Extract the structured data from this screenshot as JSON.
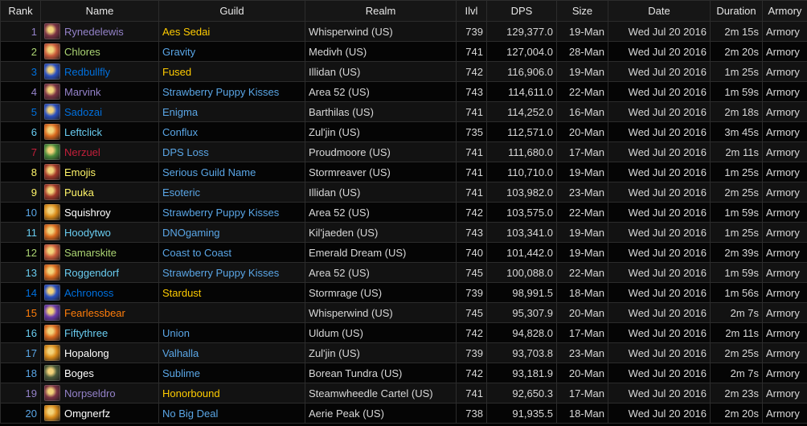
{
  "headers": {
    "rank": "Rank",
    "name": "Name",
    "guild": "Guild",
    "realm": "Realm",
    "ilvl": "Ilvl",
    "dps": "DPS",
    "size": "Size",
    "date": "Date",
    "duration": "Duration",
    "armory": "Armory"
  },
  "colors": {
    "guild_orange": "#ffcc00",
    "guild_blue": "#5aa6e6",
    "realm": "#5aa6e6",
    "dps": "#9ccc38",
    "armory": "#5aa6e6"
  },
  "rows": [
    {
      "rank": "1",
      "name": "Rynedelewis",
      "class_color": "#9482c9",
      "icon": "warlock-portrait-icon",
      "icon_color": "#7a3344",
      "guild": "Aes Sedai",
      "guild_color": "#ffcc00",
      "realm": "Whisperwind (US)",
      "ilvl": "739",
      "dps": "129,377.0",
      "size": "19-Man",
      "date": "Wed Jul 20 2016",
      "duration": "2m 15s",
      "armory": "Armory"
    },
    {
      "rank": "2",
      "name": "Chlores",
      "class_color": "#abd473",
      "icon": "hunter-portrait-icon",
      "icon_color": "#c85a3a",
      "guild": "Gravity",
      "guild_color": "#5aa6e6",
      "realm": "Medivh (US)",
      "ilvl": "741",
      "dps": "127,004.0",
      "size": "28-Man",
      "date": "Wed Jul 20 2016",
      "duration": "2m 20s",
      "armory": "Armory"
    },
    {
      "rank": "3",
      "name": "Redbullfly",
      "class_color": "#0070de",
      "icon": "shaman-lightning-icon",
      "icon_color": "#2a4fbf",
      "guild": "Fused",
      "guild_color": "#ffcc00",
      "realm": "Illidan (US)",
      "ilvl": "742",
      "dps": "116,906.0",
      "size": "19-Man",
      "date": "Wed Jul 20 2016",
      "duration": "1m 25s",
      "armory": "Armory"
    },
    {
      "rank": "4",
      "name": "Marvink",
      "class_color": "#9482c9",
      "icon": "warlock-portrait-icon",
      "icon_color": "#7a3344",
      "guild": "Strawberry Puppy Kisses",
      "guild_color": "#5aa6e6",
      "realm": "Area 52 (US)",
      "ilvl": "743",
      "dps": "114,611.0",
      "size": "22-Man",
      "date": "Wed Jul 20 2016",
      "duration": "1m 59s",
      "armory": "Armory"
    },
    {
      "rank": "5",
      "name": "Sadozai",
      "class_color": "#0070de",
      "icon": "shaman-lightning-icon",
      "icon_color": "#2a4fbf",
      "guild": "Enigma",
      "guild_color": "#5aa6e6",
      "realm": "Barthilas (US)",
      "ilvl": "741",
      "dps": "114,252.0",
      "size": "16-Man",
      "date": "Wed Jul 20 2016",
      "duration": "2m 18s",
      "armory": "Armory"
    },
    {
      "rank": "6",
      "name": "Leftclick",
      "class_color": "#69ccf0",
      "icon": "mage-fire-icon",
      "icon_color": "#d8681e",
      "guild": "Conflux",
      "guild_color": "#5aa6e6",
      "realm": "Zul'jin (US)",
      "ilvl": "735",
      "dps": "112,571.0",
      "size": "20-Man",
      "date": "Wed Jul 20 2016",
      "duration": "3m 45s",
      "armory": "Armory"
    },
    {
      "rank": "7",
      "name": "Nerzuel",
      "class_color": "#c41f3b",
      "icon": "death-knight-skull-icon",
      "icon_color": "#4a8a3a",
      "guild": "DPS Loss",
      "guild_color": "#5aa6e6",
      "realm": "Proudmoore (US)",
      "ilvl": "741",
      "dps": "111,680.0",
      "size": "17-Man",
      "date": "Wed Jul 20 2016",
      "duration": "2m 11s",
      "armory": "Armory"
    },
    {
      "rank": "8",
      "name": "Emojis",
      "class_color": "#fff569",
      "icon": "rogue-portrait-icon",
      "icon_color": "#a33a2a",
      "guild": "Serious Guild Name",
      "guild_color": "#5aa6e6",
      "realm": "Stormreaver (US)",
      "ilvl": "741",
      "dps": "110,710.0",
      "size": "19-Man",
      "date": "Wed Jul 20 2016",
      "duration": "1m 25s",
      "armory": "Armory"
    },
    {
      "rank": "9",
      "name": "Puuka",
      "class_color": "#fff569",
      "icon": "rogue-portrait-icon",
      "icon_color": "#a33a2a",
      "guild": "Esoteric",
      "guild_color": "#5aa6e6",
      "realm": "Illidan (US)",
      "ilvl": "741",
      "dps": "103,982.0",
      "size": "23-Man",
      "date": "Wed Jul 20 2016",
      "duration": "2m 25s",
      "armory": "Armory"
    },
    {
      "rank": "10",
      "name": "Squishroy",
      "class_color": "#ffffff",
      "icon": "priest-shadow-icon",
      "icon_color": "#d88a1a",
      "guild": "Strawberry Puppy Kisses",
      "guild_color": "#5aa6e6",
      "realm": "Area 52 (US)",
      "ilvl": "742",
      "dps": "103,575.0",
      "size": "22-Man",
      "date": "Wed Jul 20 2016",
      "duration": "1m 59s",
      "armory": "Armory"
    },
    {
      "rank": "11",
      "name": "Hoodytwo",
      "class_color": "#69ccf0",
      "icon": "mage-fire-icon",
      "icon_color": "#d8681e",
      "guild": "DNOgaming",
      "guild_color": "#5aa6e6",
      "realm": "Kil'jaeden (US)",
      "ilvl": "743",
      "dps": "103,341.0",
      "size": "19-Man",
      "date": "Wed Jul 20 2016",
      "duration": "1m 25s",
      "armory": "Armory"
    },
    {
      "rank": "12",
      "name": "Samarskite",
      "class_color": "#abd473",
      "icon": "hunter-portrait-icon",
      "icon_color": "#c85a3a",
      "guild": "Coast to Coast",
      "guild_color": "#5aa6e6",
      "realm": "Emerald Dream (US)",
      "ilvl": "740",
      "dps": "101,442.0",
      "size": "19-Man",
      "date": "Wed Jul 20 2016",
      "duration": "2m 39s",
      "armory": "Armory"
    },
    {
      "rank": "13",
      "name": "Roggendorf",
      "class_color": "#69ccf0",
      "icon": "mage-fire-icon",
      "icon_color": "#d8681e",
      "guild": "Strawberry Puppy Kisses",
      "guild_color": "#5aa6e6",
      "realm": "Area 52 (US)",
      "ilvl": "745",
      "dps": "100,088.0",
      "size": "22-Man",
      "date": "Wed Jul 20 2016",
      "duration": "1m 59s",
      "armory": "Armory"
    },
    {
      "rank": "14",
      "name": "Achronoss",
      "class_color": "#0070de",
      "icon": "shaman-lightning-icon",
      "icon_color": "#2a4fbf",
      "guild": "Stardust",
      "guild_color": "#ffcc00",
      "realm": "Stormrage (US)",
      "ilvl": "739",
      "dps": "98,991.5",
      "size": "18-Man",
      "date": "Wed Jul 20 2016",
      "duration": "1m 56s",
      "armory": "Armory"
    },
    {
      "rank": "15",
      "name": "Fearlessbear",
      "class_color": "#ff7d0a",
      "icon": "druid-starfall-icon",
      "icon_color": "#6a3aa8",
      "guild": "",
      "guild_color": "#5aa6e6",
      "realm": "Whisperwind (US)",
      "ilvl": "745",
      "dps": "95,307.9",
      "size": "20-Man",
      "date": "Wed Jul 20 2016",
      "duration": "2m 7s",
      "armory": "Armory"
    },
    {
      "rank": "16",
      "name": "Fiftythree",
      "class_color": "#69ccf0",
      "icon": "mage-fire-icon",
      "icon_color": "#d8681e",
      "guild": "Union",
      "guild_color": "#5aa6e6",
      "realm": "Uldum (US)",
      "ilvl": "742",
      "dps": "94,828.0",
      "size": "17-Man",
      "date": "Wed Jul 20 2016",
      "duration": "2m 11s",
      "armory": "Armory"
    },
    {
      "rank": "17",
      "name": "Hopalong",
      "class_color": "#ffffff",
      "icon": "priest-shadow-icon",
      "icon_color": "#d88a1a",
      "guild": "Valhalla",
      "guild_color": "#5aa6e6",
      "realm": "Zul'jin (US)",
      "ilvl": "739",
      "dps": "93,703.8",
      "size": "23-Man",
      "date": "Wed Jul 20 2016",
      "duration": "2m 25s",
      "armory": "Armory"
    },
    {
      "rank": "18",
      "name": "Boges",
      "class_color": "#ffffff",
      "icon": "priest-hood-icon",
      "icon_color": "#4a5a3a",
      "guild": "Sublime",
      "guild_color": "#5aa6e6",
      "realm": "Borean Tundra (US)",
      "ilvl": "742",
      "dps": "93,181.9",
      "size": "20-Man",
      "date": "Wed Jul 20 2016",
      "duration": "2m 7s",
      "armory": "Armory"
    },
    {
      "rank": "19",
      "name": "Norpseldro",
      "class_color": "#9482c9",
      "icon": "warlock-portrait-icon",
      "icon_color": "#7a3344",
      "guild": "Honorbound",
      "guild_color": "#ffcc00",
      "realm": "Steamwheedle Cartel (US)",
      "ilvl": "741",
      "dps": "92,650.3",
      "size": "17-Man",
      "date": "Wed Jul 20 2016",
      "duration": "2m 23s",
      "armory": "Armory"
    },
    {
      "rank": "20",
      "name": "Omgnerfz",
      "class_color": "#ffffff",
      "icon": "priest-shadow-icon",
      "icon_color": "#d88a1a",
      "guild": "No Big Deal",
      "guild_color": "#5aa6e6",
      "realm": "Aerie Peak (US)",
      "ilvl": "738",
      "dps": "91,935.5",
      "size": "18-Man",
      "date": "Wed Jul 20 2016",
      "duration": "2m 20s",
      "armory": "Armory"
    }
  ]
}
